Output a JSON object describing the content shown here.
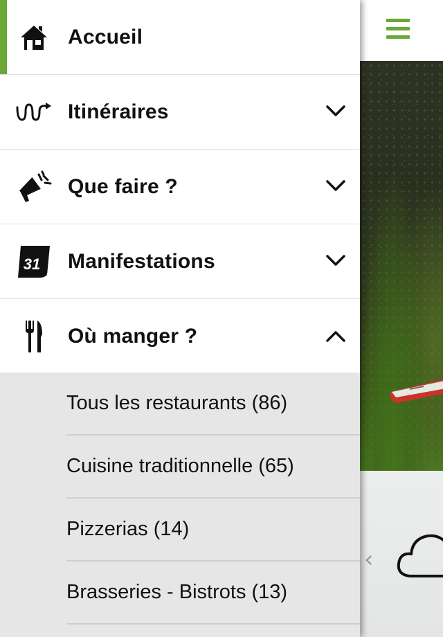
{
  "drawer": {
    "items": [
      {
        "label": "Accueil",
        "icon": "home-icon",
        "active": true
      },
      {
        "label": "Itinéraires",
        "icon": "route-icon",
        "expandable": true
      },
      {
        "label": "Que faire ?",
        "icon": "megaphone-icon",
        "expandable": true
      },
      {
        "label": "Manifestations",
        "icon": "calendar-icon",
        "expandable": true,
        "icon_text": "31"
      },
      {
        "label": "Où manger ?",
        "icon": "cutlery-icon",
        "expandable": true,
        "expanded": true
      }
    ],
    "submenu": [
      {
        "label": "Tous les restaurants (86)"
      },
      {
        "label": "Cuisine traditionnelle (65)"
      },
      {
        "label": "Pizzerias (14)"
      },
      {
        "label": "Brasseries - Bistrots (13)"
      }
    ]
  },
  "header": {
    "menu_icon": "hamburger-icon"
  },
  "colors": {
    "accent": "#6aa837",
    "submenu_bg": "#e6e6e6"
  }
}
